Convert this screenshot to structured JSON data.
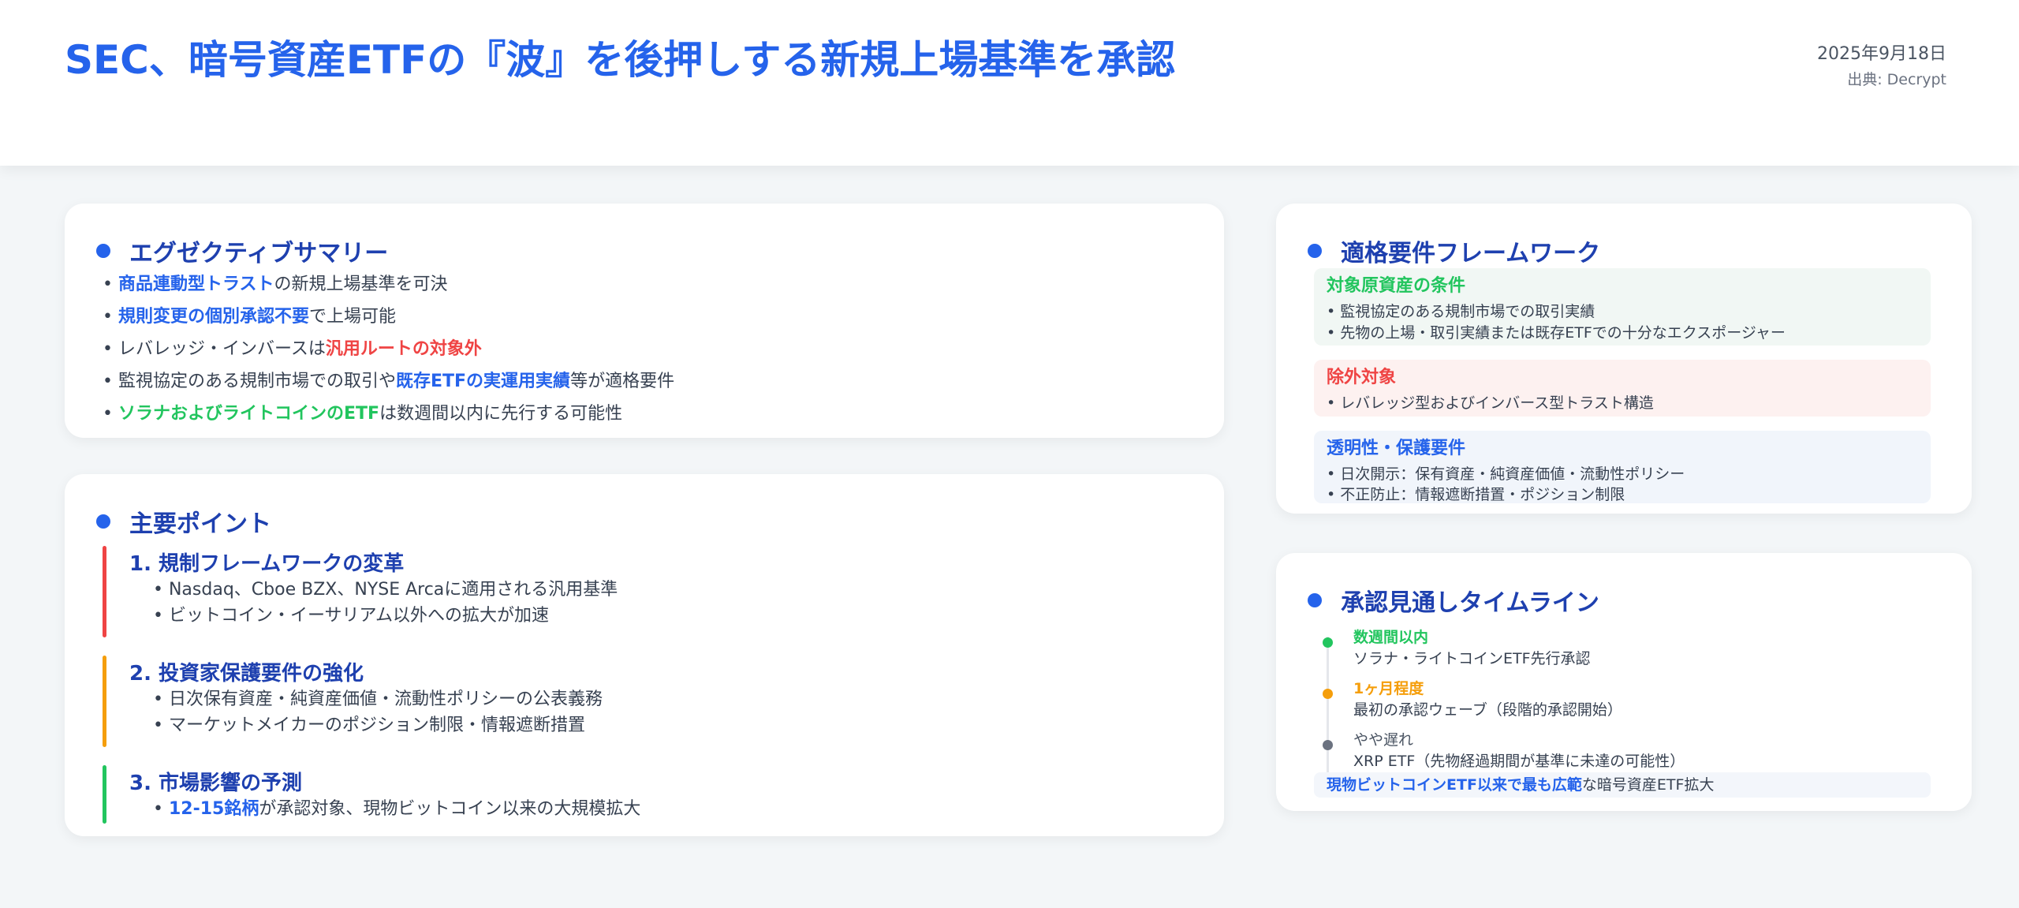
{
  "header": {
    "title": "SEC、暗号資産ETFの『波』を後押しする新規上場基準を承認",
    "date": "2025年9月18日",
    "source": "出典: Decrypt"
  },
  "summary": {
    "title": "エグゼクティブサマリー",
    "items": [
      {
        "pre": "• ",
        "hl": "商品連動型トラスト",
        "post": "の新規上場基準を可決"
      },
      {
        "pre": "• ",
        "hl": "規則変更の個別承認不要",
        "post": "で上場可能"
      },
      {
        "pre": "• レバレッジ・インバースは",
        "hl": "汎用ルートの対象外",
        "post": ""
      },
      {
        "pre": "• 監視協定のある規制市場での取引や",
        "hl": "既存ETFの実運用実績",
        "post": "等が適格要件"
      },
      {
        "pre": "• ",
        "hl": "ソラナおよびライトコインのETF",
        "post": "は数週間以内に先行する可能性"
      }
    ]
  },
  "points": {
    "title": "主要ポイント",
    "items": [
      {
        "title": "1. 規制フレームワークの変革",
        "lines": [
          "• Nasdaq、Cboe BZX、NYSE Arcaに適用される汎用基準",
          "• ビットコイン・イーサリアム以外への拡大が加速"
        ]
      },
      {
        "title": "2. 投資家保護要件の強化",
        "lines": [
          "• 日次保有資産・純資産価値・流動性ポリシーの公表義務",
          "• マーケットメイカーのポジション制限・情報遮断措置"
        ]
      },
      {
        "title": "3. 市場影響の予測",
        "hl": "12-15銘柄",
        "post": "が承認対象、現物ビットコイン以来の大規模拡大"
      }
    ]
  },
  "framework": {
    "title": "適格要件フレームワーク",
    "sections": [
      {
        "title": "対象原資産の条件",
        "lines": [
          "• 監視協定のある規制市場での取引実績",
          "• 先物の上場・取引実績または既存ETFでの十分なエクスポージャー"
        ]
      },
      {
        "title": "除外対象",
        "lines": [
          "• レバレッジ型およびインバース型トラスト構造"
        ]
      },
      {
        "title": "透明性・保護要件",
        "lines": [
          "• 日次開示：保有資産・純資産価値・流動性ポリシー",
          "• 不正防止：情報遮断措置・ポジション制限"
        ]
      }
    ]
  },
  "timeline": {
    "title": "承認見通しタイムライン",
    "items": [
      {
        "label": "数週間以内",
        "desc": "ソラナ・ライトコインETF先行承認"
      },
      {
        "label": "1ヶ月程度",
        "desc": "最初の承認ウェーブ（段階的承認開始）"
      },
      {
        "label": "やや遅れ",
        "desc": "XRP ETF（先物経過期間が基準に未達の可能性）"
      }
    ],
    "footer_hl": "現物ビットコインETF以来で最も広範",
    "footer_post": "な暗号資産ETF拡大"
  },
  "colors": {
    "accent": "#2563eb",
    "heading": "#1e40af",
    "red": "#ef4444",
    "orange": "#f59e0b",
    "green": "#22c55e",
    "gray": "#6b7280"
  }
}
